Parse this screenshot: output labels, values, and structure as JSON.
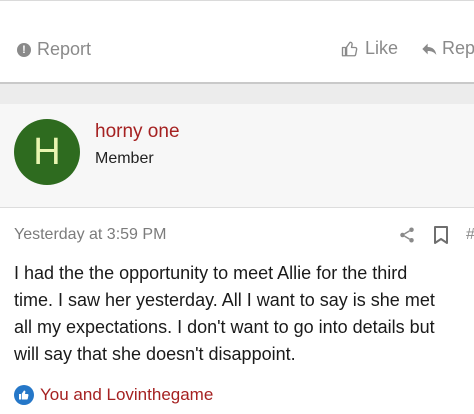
{
  "actions": {
    "report_label": "Report",
    "like_label": "Like",
    "reply_label": "Rep"
  },
  "user": {
    "avatar_letter": "H",
    "avatar_color": "#2e6b1f",
    "name": "horny one",
    "title": "Member"
  },
  "post": {
    "timestamp": "Yesterday at 3:59 PM",
    "hash": "#",
    "body": "I had the the opportunity to meet Allie for the third\ntime. I saw her yesterday. All I want to say is she met\nall my expectations. I don't want to go into details but\nwill say that she doesn't disappoint.",
    "likes_text": "You and Lovinthegame"
  },
  "colors": {
    "username": "#a52121",
    "like_badge": "#2577c8"
  }
}
